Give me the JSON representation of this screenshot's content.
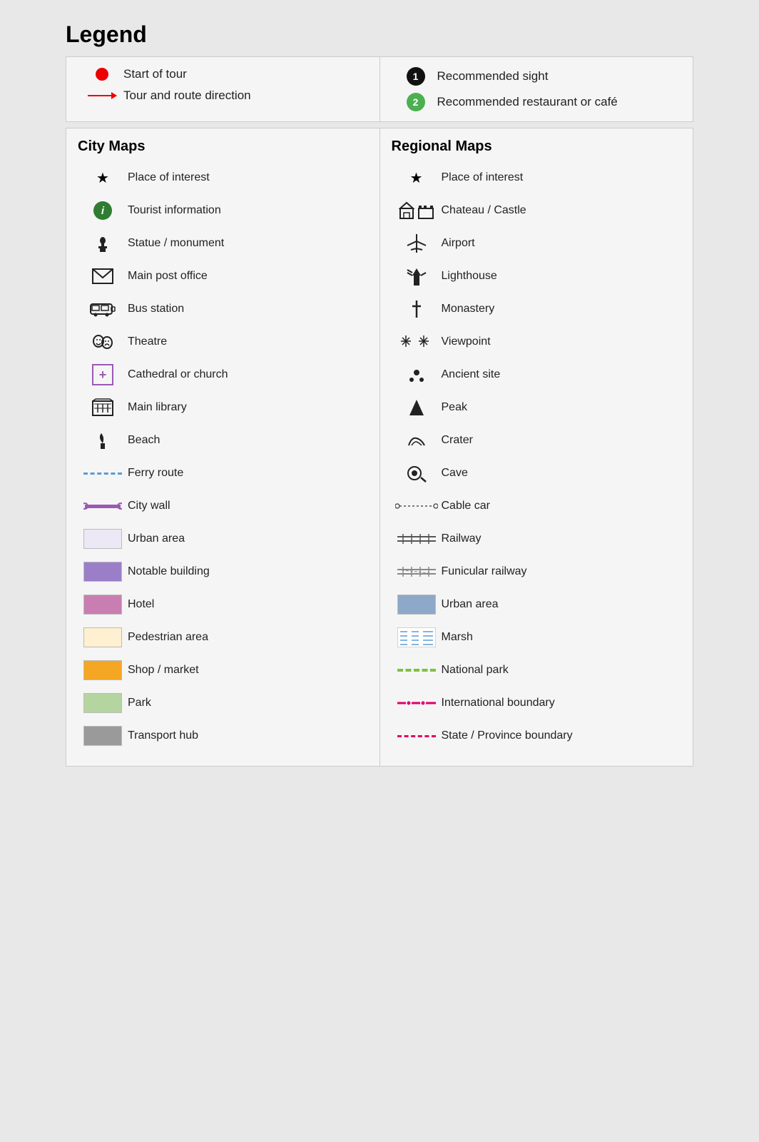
{
  "title": "Legend",
  "top": {
    "left": [
      {
        "icon": "red-dot",
        "label": "Start of tour"
      },
      {
        "icon": "red-arrow",
        "label": "Tour and route direction"
      }
    ],
    "right": [
      {
        "icon": "black-1",
        "label": "Recommended sight"
      },
      {
        "icon": "green-2",
        "label": "Recommended restaurant or café"
      }
    ]
  },
  "city_maps": {
    "title": "City Maps",
    "items": [
      {
        "icon": "star",
        "label": "Place of interest"
      },
      {
        "icon": "green-info",
        "label": "Tourist information"
      },
      {
        "icon": "chess",
        "label": "Statue / monument"
      },
      {
        "icon": "envelope",
        "label": "Main post office"
      },
      {
        "icon": "bus",
        "label": "Bus station"
      },
      {
        "icon": "theatre",
        "label": "Theatre"
      },
      {
        "icon": "purple-cross",
        "label": "Cathedral or church"
      },
      {
        "icon": "library",
        "label": "Main library"
      },
      {
        "icon": "beach",
        "label": "Beach"
      },
      {
        "icon": "ferry",
        "label": "Ferry route"
      },
      {
        "icon": "citywall",
        "label": "City wall"
      },
      {
        "icon": "swatch-urban",
        "label": "Urban area"
      },
      {
        "icon": "swatch-notable",
        "label": "Notable building"
      },
      {
        "icon": "swatch-hotel",
        "label": "Hotel"
      },
      {
        "icon": "swatch-pedestrian",
        "label": "Pedestrian area"
      },
      {
        "icon": "swatch-shop",
        "label": "Shop / market"
      },
      {
        "icon": "swatch-park",
        "label": "Park"
      },
      {
        "icon": "swatch-transport",
        "label": "Transport hub"
      }
    ]
  },
  "regional_maps": {
    "title": "Regional Maps",
    "items": [
      {
        "icon": "star",
        "label": "Place of interest"
      },
      {
        "icon": "chateau",
        "label": "Chateau / Castle"
      },
      {
        "icon": "airport",
        "label": "Airport"
      },
      {
        "icon": "lighthouse",
        "label": "Lighthouse"
      },
      {
        "icon": "monastery",
        "label": "Monastery"
      },
      {
        "icon": "viewpoint",
        "label": "Viewpoint"
      },
      {
        "icon": "ancient",
        "label": "Ancient site"
      },
      {
        "icon": "peak",
        "label": "Peak"
      },
      {
        "icon": "crater",
        "label": "Crater"
      },
      {
        "icon": "cave",
        "label": "Cave"
      },
      {
        "icon": "cablecar",
        "label": "Cable car"
      },
      {
        "icon": "railway",
        "label": "Railway"
      },
      {
        "icon": "funicular",
        "label": "Funicular railway"
      },
      {
        "icon": "swatch-urban-regional",
        "label": "Urban area"
      },
      {
        "icon": "swatch-marsh",
        "label": "Marsh"
      },
      {
        "icon": "national-park",
        "label": "National park"
      },
      {
        "icon": "intl-boundary",
        "label": "International boundary"
      },
      {
        "icon": "state-boundary",
        "label": "State / Province boundary"
      }
    ]
  }
}
